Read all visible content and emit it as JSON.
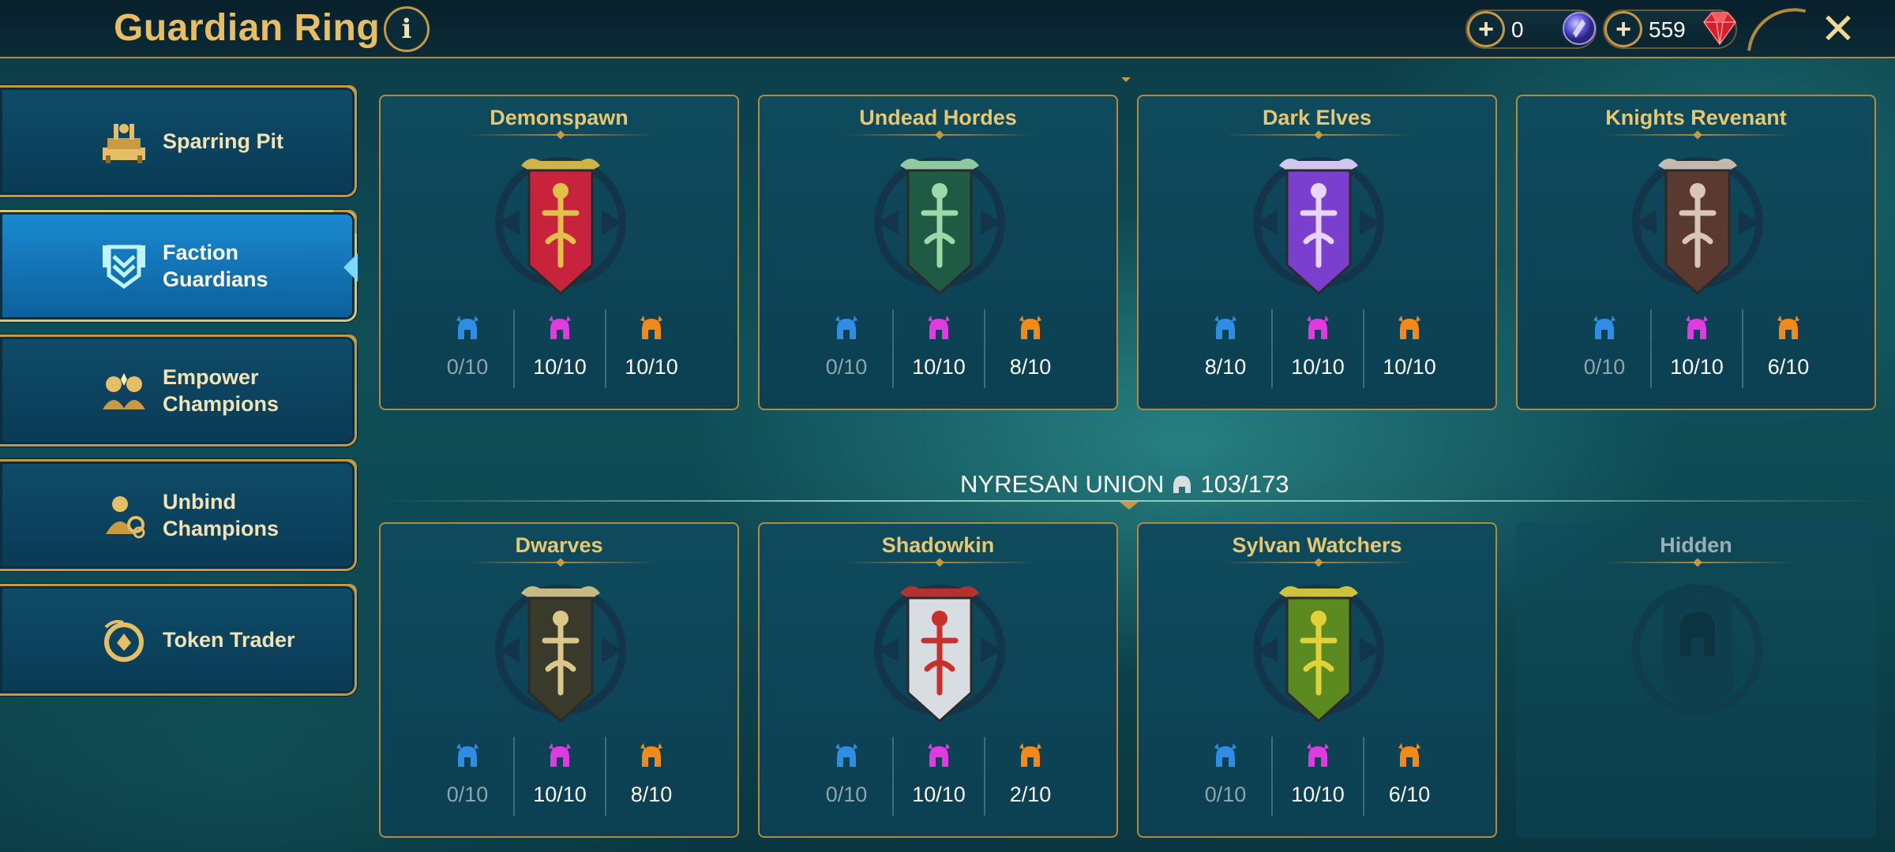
{
  "header": {
    "title": "Guardian Ring",
    "info_icon": "info-icon",
    "currencies": [
      {
        "value": "0",
        "icon": "blue-token-icon"
      },
      {
        "value": "559",
        "icon": "ruby-gem-icon"
      }
    ]
  },
  "sidebar": {
    "items": [
      {
        "label": "Sparring Pit",
        "icon": "sparring-pit-icon",
        "active": false
      },
      {
        "label": "Faction\nGuardians",
        "icon": "faction-guardians-icon",
        "active": true
      },
      {
        "label": "Empower\nChampions",
        "icon": "empower-champions-icon",
        "active": false
      },
      {
        "label": "Unbind\nChampions",
        "icon": "unbind-champions-icon",
        "active": false
      },
      {
        "label": "Token Trader",
        "icon": "token-trader-icon",
        "active": false
      }
    ]
  },
  "union": {
    "name": "NYRESAN UNION",
    "progress": "103/173",
    "icon": "helmet-icon"
  },
  "factions": [
    {
      "name": "Demonspawn",
      "stats": [
        "0/10",
        "10/10",
        "10/10"
      ],
      "colors": [
        "#c8233c",
        "#e2c14a"
      ]
    },
    {
      "name": "Undead Hordes",
      "stats": [
        "0/10",
        "10/10",
        "8/10"
      ],
      "colors": [
        "#1e5a44",
        "#9fd8a8"
      ]
    },
    {
      "name": "Dark Elves",
      "stats": [
        "8/10",
        "10/10",
        "10/10"
      ],
      "colors": [
        "#7a3fcf",
        "#e7d6ff"
      ]
    },
    {
      "name": "Knights Revenant",
      "stats": [
        "0/10",
        "10/10",
        "6/10"
      ],
      "colors": [
        "#5a3a30",
        "#d8c7b8"
      ]
    },
    {
      "name": "Dwarves",
      "stats": [
        "0/10",
        "10/10",
        "8/10"
      ],
      "colors": [
        "#3a3a2a",
        "#d9c88a"
      ]
    },
    {
      "name": "Shadowkin",
      "stats": [
        "0/10",
        "10/10",
        "2/10"
      ],
      "colors": [
        "#d8dde2",
        "#c8302c"
      ]
    },
    {
      "name": "Sylvan Watchers",
      "stats": [
        "0/10",
        "10/10",
        "6/10"
      ],
      "colors": [
        "#5a8a20",
        "#e2d23a"
      ]
    },
    {
      "name": "Hidden",
      "stats": [],
      "colors": [
        "#0e4858",
        "#0e4858"
      ]
    }
  ],
  "rarity_colors": {
    "rare": "#2f8de4",
    "epic": "#e03be0",
    "legendary": "#f08a1a"
  }
}
